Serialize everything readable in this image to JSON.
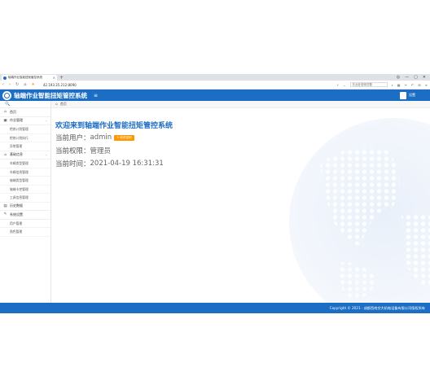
{
  "browser": {
    "tab_title": "轴端作业智能扭矩管控系统",
    "tab_close": "×",
    "new_tab": "+",
    "url": "42.193.35.212:8090",
    "search_placeholder": "在此处搜索您要",
    "window_controls": [
      "◎",
      "—",
      "▢",
      "✕"
    ]
  },
  "header": {
    "title": "轴端作业智能扭矩管控系统",
    "menu_icon": "≡",
    "user_label": "设置"
  },
  "sidebar": {
    "search_icon": "🔍",
    "items": [
      {
        "type": "item",
        "icon": "⌂",
        "label": "首页"
      },
      {
        "type": "group",
        "icon": "▣",
        "label": "作业管理",
        "chevron": "⌄"
      },
      {
        "type": "sub",
        "label": "检修计划管理"
      },
      {
        "type": "sub",
        "label": "检修计划执行"
      },
      {
        "type": "sub",
        "label": "异常管理"
      },
      {
        "type": "group",
        "icon": "⌂",
        "label": "基础信息",
        "chevron": "⌄"
      },
      {
        "type": "sub",
        "label": "车辆类型管理"
      },
      {
        "type": "sub",
        "label": "车辆信息管理"
      },
      {
        "type": "sub",
        "label": "轴端类型管理"
      },
      {
        "type": "sub",
        "label": "轴端卡控管理"
      },
      {
        "type": "sub",
        "label": "工具信息管理"
      },
      {
        "type": "item",
        "icon": "▤",
        "label": "历史数据"
      },
      {
        "type": "group",
        "icon": "✎",
        "label": "系统设置"
      },
      {
        "type": "sub",
        "label": "用户管理"
      },
      {
        "type": "sub",
        "label": "角色管理"
      }
    ]
  },
  "breadcrumb": {
    "home_icon": "⌂",
    "label": "首页"
  },
  "main": {
    "welcome": "欢迎来到轴端作业智能扭矩管控系统",
    "user_label": "当前用户：",
    "user_value": "admin",
    "edit_button": "✎ 修改密码",
    "role_label": "当前权限：",
    "role_value": "管理员",
    "time_label": "当前时间：",
    "time_value": "2021-04-19 16:31:31"
  },
  "footer": {
    "text": "Copyright © 2021 · 成都西南交大机电设备有限公司版权所有"
  },
  "colors": {
    "primary": "#1c6ec4",
    "accent": "#ff9800"
  }
}
